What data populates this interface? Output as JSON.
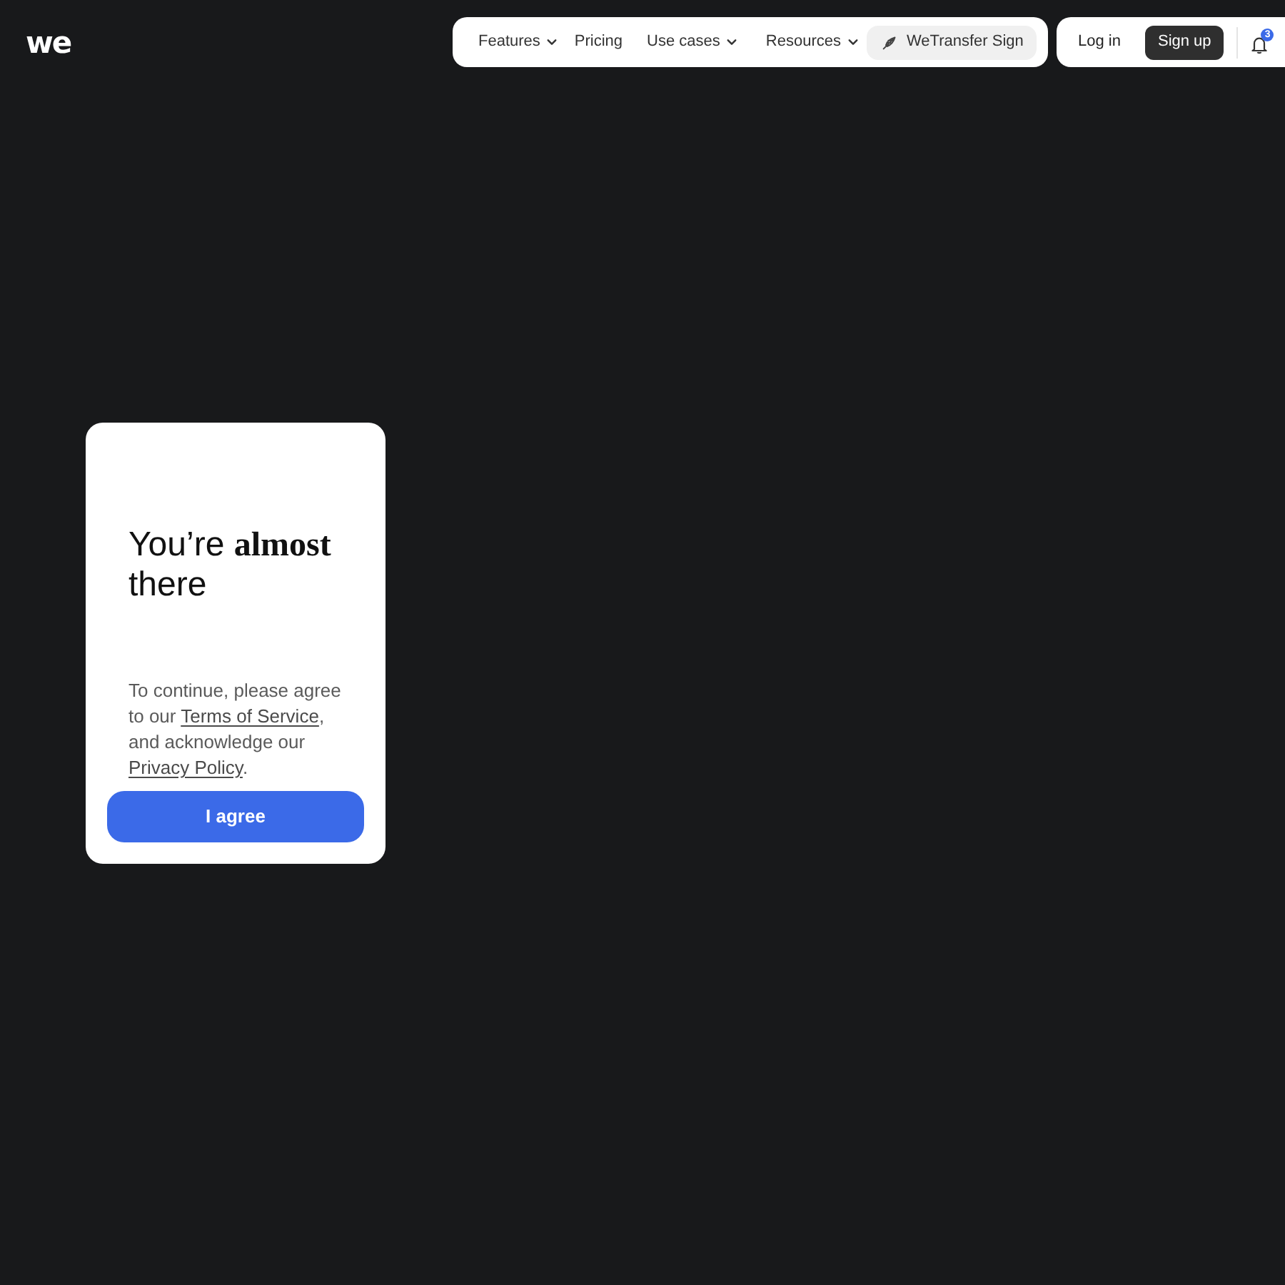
{
  "logo": {
    "text": "we"
  },
  "nav": {
    "items": [
      {
        "label": "Features",
        "has_menu": true,
        "highlighted": false
      },
      {
        "label": "Pricing",
        "has_menu": false,
        "highlighted": false
      },
      {
        "label": "Use cases",
        "has_menu": true,
        "highlighted": false
      },
      {
        "label": "Resources",
        "has_menu": true,
        "highlighted": false
      },
      {
        "label": "WeTransfer Sign",
        "has_menu": false,
        "highlighted": true
      }
    ]
  },
  "account": {
    "buttons": [
      {
        "label": "Log in",
        "kind": "plain"
      },
      {
        "label": "Sign up",
        "kind": "filled"
      }
    ],
    "notification_count": "3"
  },
  "consent_card": {
    "heading": "You’re **almost** there",
    "parts": [
      {
        "kind": "text",
        "text": "To continue, please agree to our "
      },
      {
        "kind": "link",
        "text": "Terms of Service"
      },
      {
        "kind": "text",
        "text": ", and acknowledge our "
      },
      {
        "kind": "link",
        "text": "Privacy Policy"
      },
      {
        "kind": "text",
        "text": "."
      }
    ],
    "button": "I agree"
  }
}
